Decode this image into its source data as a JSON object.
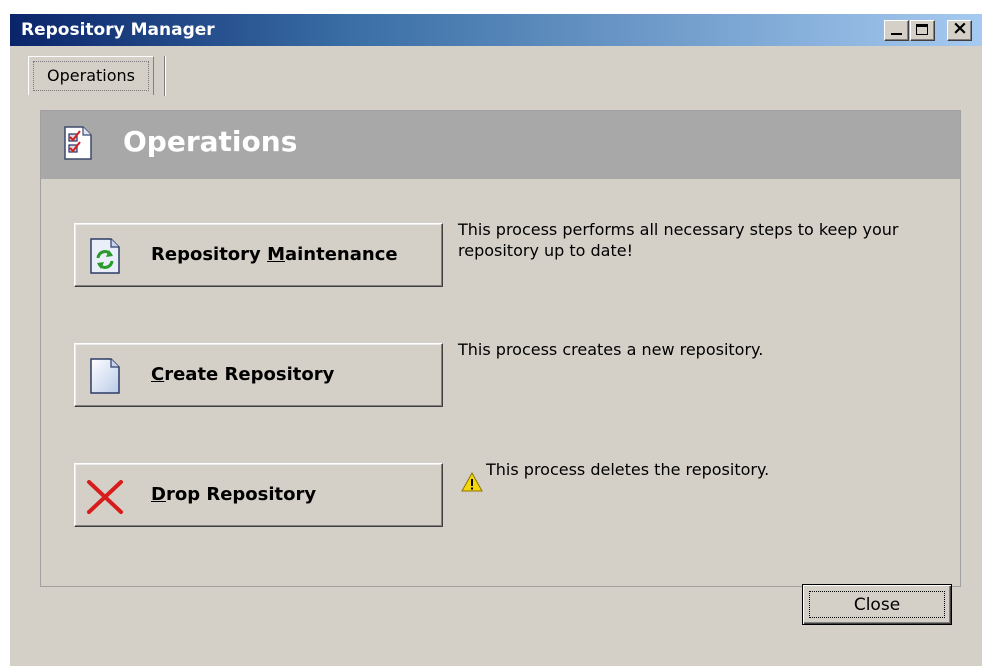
{
  "window": {
    "title": "Repository Manager"
  },
  "tabs": [
    {
      "label": "Operations",
      "selected": true
    }
  ],
  "panel": {
    "title": "Operations"
  },
  "operations": [
    {
      "label_pre": "Repository ",
      "label_mnemonic": "M",
      "label_post": "aintenance",
      "description": "This process performs all necessary steps to keep your repository up to date!"
    },
    {
      "label_pre": "",
      "label_mnemonic": "C",
      "label_post": "reate Repository",
      "description": "This process creates a new repository."
    },
    {
      "label_pre": "",
      "label_mnemonic": "D",
      "label_post": "rop Repository",
      "description": "This process deletes the repository."
    }
  ],
  "footer": {
    "close_label": "Close"
  },
  "colors": {
    "title_gradient_start": "#0a246a",
    "title_gradient_end": "#a6caf0",
    "panel_header": "#a8a8a8",
    "window_face": "#d4d0c8",
    "drop_icon_red": "#d81c1c",
    "warning_yellow": "#f5d60a"
  }
}
